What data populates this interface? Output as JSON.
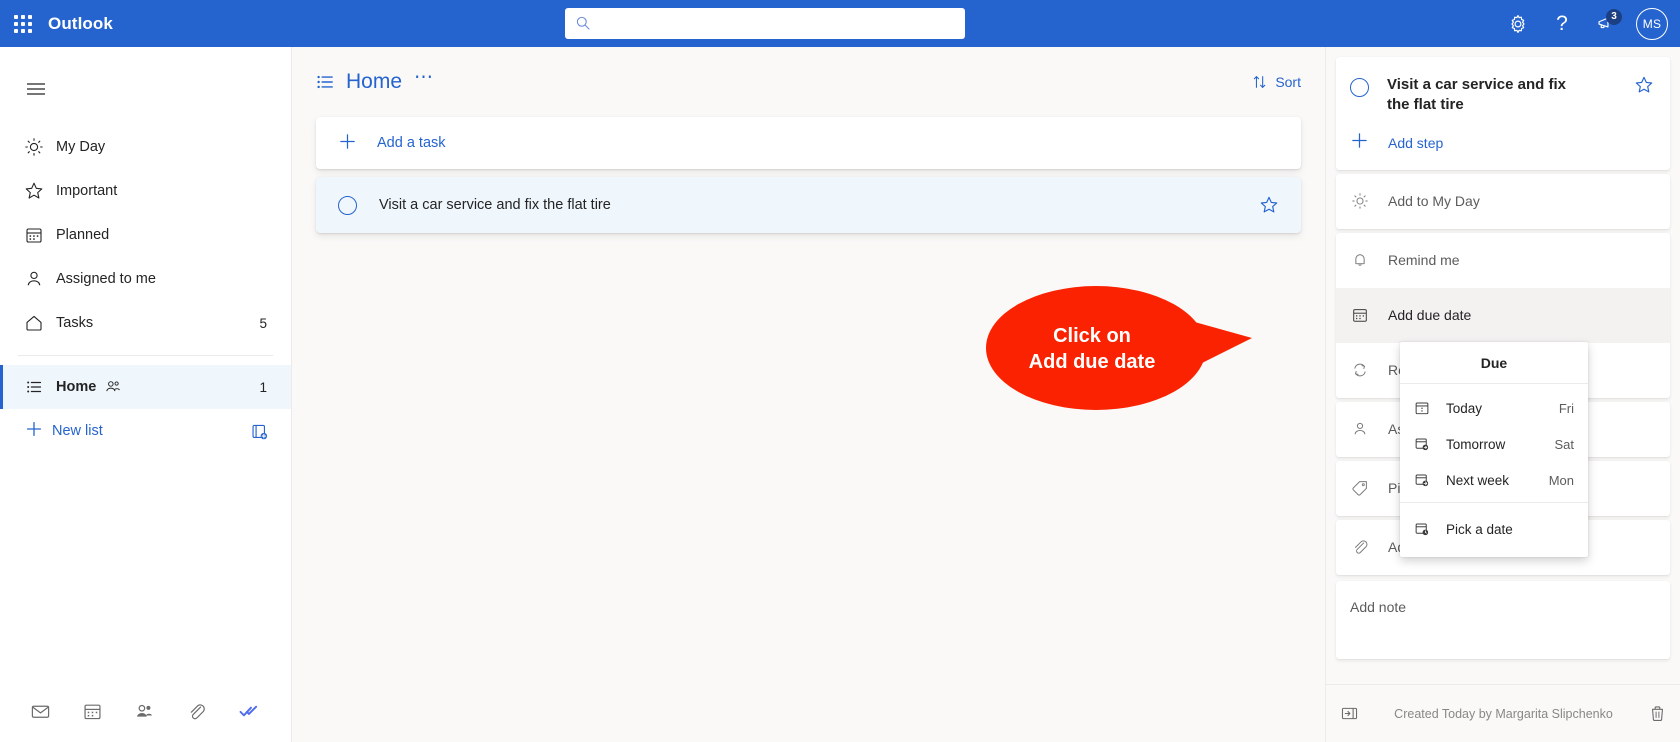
{
  "header": {
    "app_launcher": "waffle-grid-icon",
    "brand": "Outlook",
    "search_placeholder": "",
    "search_value": "",
    "settings_icon": "gear-icon",
    "help_icon": "question-mark-icon",
    "feedback_icon": "megaphone-icon",
    "feedback_badge": "3",
    "avatar_initials": "MS",
    "accent_color": "#2564cf"
  },
  "sidebar": {
    "hamburger_icon": "hamburger-menu-icon",
    "items": [
      {
        "label": "My Day",
        "icon": "sun-icon",
        "count": ""
      },
      {
        "label": "Important",
        "icon": "star-icon",
        "count": ""
      },
      {
        "label": "Planned",
        "icon": "calendar-icon",
        "count": ""
      },
      {
        "label": "Assigned to me",
        "icon": "person-icon",
        "count": ""
      },
      {
        "label": "Tasks",
        "icon": "home-icon",
        "count": "5"
      }
    ],
    "lists": [
      {
        "label": "Home",
        "icon": "list-icon",
        "count": "1",
        "shared": true,
        "selected": true
      }
    ],
    "new_list_label": "New list",
    "new_list_icon": "plus-icon",
    "new_group_icon": "new-list-group-icon",
    "app_switcher": [
      {
        "name": "mail-icon"
      },
      {
        "name": "calendar-icon"
      },
      {
        "name": "people-icon"
      },
      {
        "name": "files-icon"
      },
      {
        "name": "todo-icon"
      }
    ]
  },
  "main": {
    "list_icon": "list-icon",
    "title": "Home",
    "more_options": "⋯",
    "sort_label": "Sort",
    "sort_icon": "sort-arrows-icon",
    "add_task_placeholder": "Add a task",
    "add_task_icon": "plus-icon",
    "tasks": [
      {
        "title": "Visit a car service and fix the flat tire",
        "completed": false,
        "important": false
      }
    ]
  },
  "detail": {
    "task_title": "Visit a car service and fix the flat tire",
    "star_icon": "star-icon",
    "add_step_label": "Add step",
    "add_step_icon": "plus-icon",
    "options": [
      {
        "label": "Add to My Day",
        "icon": "sun-icon",
        "active": false
      },
      {
        "label": "Remind me",
        "icon": "bell-icon",
        "active": false
      },
      {
        "label": "Add due date",
        "icon": "calendar-icon",
        "active": true
      },
      {
        "label": "Repeat",
        "icon": "repeat-icon",
        "active": false
      },
      {
        "label": "Assign to",
        "icon": "person-icon",
        "active": false
      },
      {
        "label": "Pick a category",
        "icon": "tag-icon",
        "active": false
      },
      {
        "label": "Add file",
        "icon": "paperclip-icon",
        "active": false
      }
    ],
    "note_placeholder": "Add note",
    "footer_text": "Created Today by Margarita Slipchenko",
    "collapse_icon": "collapse-pane-icon",
    "delete_icon": "trash-icon"
  },
  "due_menu": {
    "title": "Due",
    "items": [
      {
        "label": "Today",
        "day": "Fri",
        "icon": "calendar-today-icon"
      },
      {
        "label": "Tomorrow",
        "day": "Sat",
        "icon": "calendar-tomorrow-icon"
      },
      {
        "label": "Next week",
        "day": "Mon",
        "icon": "calendar-nextweek-icon"
      }
    ],
    "pick_a_date": {
      "label": "Pick a date",
      "day": "",
      "icon": "calendar-pick-icon"
    }
  },
  "callout": {
    "line1": "Click on",
    "line2": "Add due date",
    "color": "#fa2200"
  }
}
